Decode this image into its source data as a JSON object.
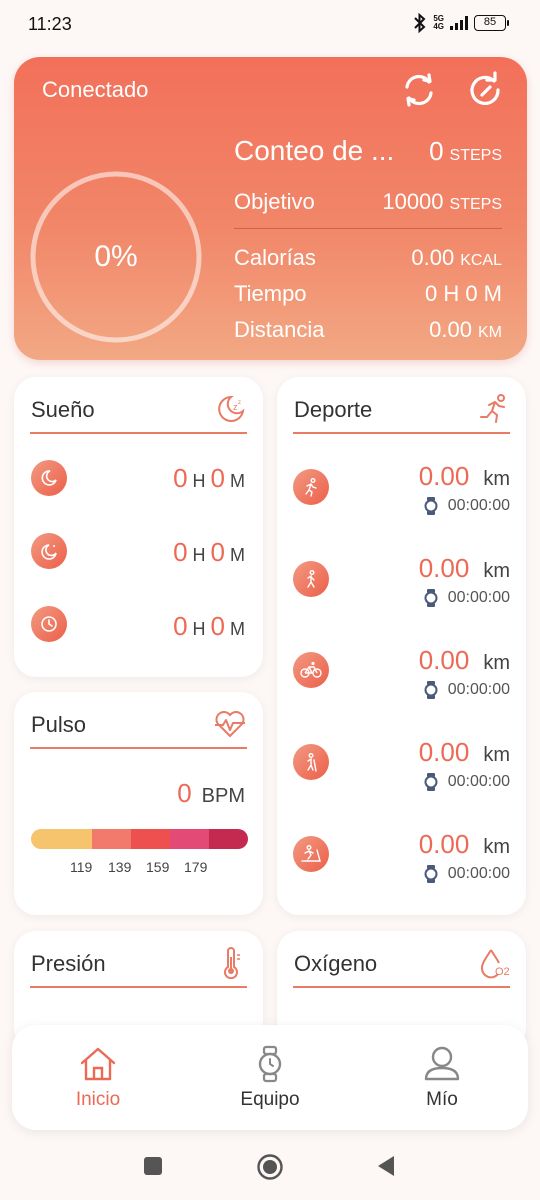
{
  "status_bar": {
    "time": "11:23",
    "network_top": "5G",
    "network_bottom": "4G",
    "battery": "85"
  },
  "header": {
    "connection_status": "Conectado",
    "sync_icon": "sync-icon",
    "refresh_icon": "refresh-icon",
    "progress": "0%",
    "progress_fraction": 0,
    "steps": {
      "label": "Conteo de ...",
      "value": "0",
      "unit": "STEPS"
    },
    "goal": {
      "label": "Objetivo",
      "value": "10000",
      "unit": "STEPS"
    },
    "calories": {
      "label": "Calorías",
      "value": "0.00",
      "unit": "KCAL"
    },
    "time": {
      "label": "Tiempo",
      "value": "0 H 0 M"
    },
    "distance": {
      "label": "Distancia",
      "value": "0.00",
      "unit": "KM"
    }
  },
  "sleep": {
    "title": "Sueño",
    "icon": "sleep-moon-icon",
    "rows": [
      {
        "icon": "moon-icon",
        "hours": "0",
        "h": "H",
        "minutes": "0",
        "m": "M"
      },
      {
        "icon": "moon-stars-icon",
        "hours": "0",
        "h": "H",
        "minutes": "0",
        "m": "M"
      },
      {
        "icon": "clock-icon",
        "hours": "0",
        "h": "H",
        "minutes": "0",
        "m": "M"
      }
    ]
  },
  "pulse": {
    "title": "Pulso",
    "icon": "heart-pulse-icon",
    "value": "0",
    "unit": "BPM",
    "ticks": [
      "119",
      "139",
      "159",
      "179"
    ],
    "zone_colors": [
      "#f6c46c",
      "#f27a6c",
      "#ee5050",
      "#e34a76",
      "#c42a50"
    ]
  },
  "sport": {
    "title": "Deporte",
    "icon": "running-icon",
    "rows": [
      {
        "icon": "run-icon",
        "distance": "0.00",
        "unit": "km",
        "time": "00:00:00"
      },
      {
        "icon": "walk-icon",
        "distance": "0.00",
        "unit": "km",
        "time": "00:00:00"
      },
      {
        "icon": "bike-icon",
        "distance": "0.00",
        "unit": "km",
        "time": "00:00:00"
      },
      {
        "icon": "hike-icon",
        "distance": "0.00",
        "unit": "km",
        "time": "00:00:00"
      },
      {
        "icon": "treadmill-icon",
        "distance": "0.00",
        "unit": "km",
        "time": "00:00:00"
      }
    ]
  },
  "pressure": {
    "title": "Presión",
    "icon": "thermometer-icon"
  },
  "oxygen": {
    "title": "Oxígeno",
    "icon": "oxygen-drop-icon",
    "icon_text": "O2"
  },
  "nav": {
    "home": "Inicio",
    "device": "Equipo",
    "me": "Mío"
  },
  "colors": {
    "accent": "#ec6a55",
    "header_top": "#f2705a",
    "header_bottom": "#f2a884"
  }
}
